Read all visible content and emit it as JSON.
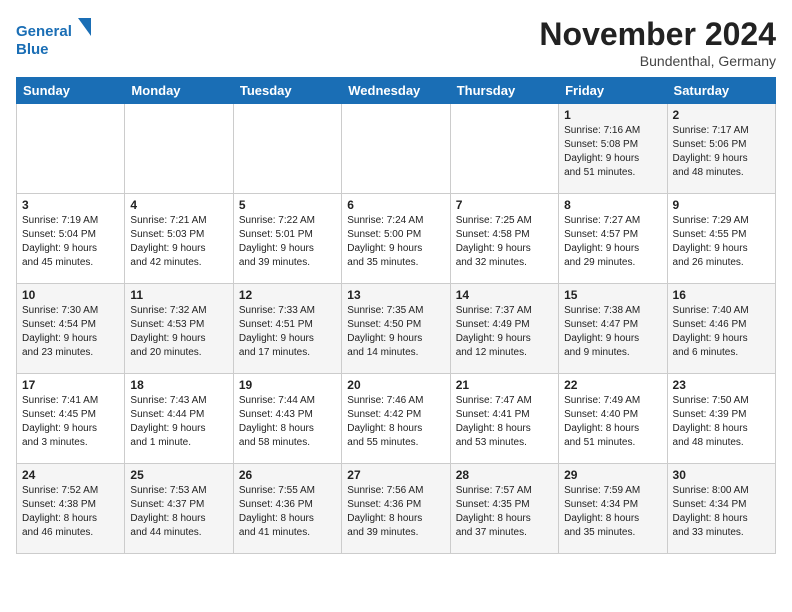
{
  "header": {
    "logo_line1": "General",
    "logo_line2": "Blue",
    "month": "November 2024",
    "location": "Bundenthal, Germany"
  },
  "weekdays": [
    "Sunday",
    "Monday",
    "Tuesday",
    "Wednesday",
    "Thursday",
    "Friday",
    "Saturday"
  ],
  "weeks": [
    [
      {
        "day": "",
        "info": ""
      },
      {
        "day": "",
        "info": ""
      },
      {
        "day": "",
        "info": ""
      },
      {
        "day": "",
        "info": ""
      },
      {
        "day": "",
        "info": ""
      },
      {
        "day": "1",
        "info": "Sunrise: 7:16 AM\nSunset: 5:08 PM\nDaylight: 9 hours\nand 51 minutes."
      },
      {
        "day": "2",
        "info": "Sunrise: 7:17 AM\nSunset: 5:06 PM\nDaylight: 9 hours\nand 48 minutes."
      }
    ],
    [
      {
        "day": "3",
        "info": "Sunrise: 7:19 AM\nSunset: 5:04 PM\nDaylight: 9 hours\nand 45 minutes."
      },
      {
        "day": "4",
        "info": "Sunrise: 7:21 AM\nSunset: 5:03 PM\nDaylight: 9 hours\nand 42 minutes."
      },
      {
        "day": "5",
        "info": "Sunrise: 7:22 AM\nSunset: 5:01 PM\nDaylight: 9 hours\nand 39 minutes."
      },
      {
        "day": "6",
        "info": "Sunrise: 7:24 AM\nSunset: 5:00 PM\nDaylight: 9 hours\nand 35 minutes."
      },
      {
        "day": "7",
        "info": "Sunrise: 7:25 AM\nSunset: 4:58 PM\nDaylight: 9 hours\nand 32 minutes."
      },
      {
        "day": "8",
        "info": "Sunrise: 7:27 AM\nSunset: 4:57 PM\nDaylight: 9 hours\nand 29 minutes."
      },
      {
        "day": "9",
        "info": "Sunrise: 7:29 AM\nSunset: 4:55 PM\nDaylight: 9 hours\nand 26 minutes."
      }
    ],
    [
      {
        "day": "10",
        "info": "Sunrise: 7:30 AM\nSunset: 4:54 PM\nDaylight: 9 hours\nand 23 minutes."
      },
      {
        "day": "11",
        "info": "Sunrise: 7:32 AM\nSunset: 4:53 PM\nDaylight: 9 hours\nand 20 minutes."
      },
      {
        "day": "12",
        "info": "Sunrise: 7:33 AM\nSunset: 4:51 PM\nDaylight: 9 hours\nand 17 minutes."
      },
      {
        "day": "13",
        "info": "Sunrise: 7:35 AM\nSunset: 4:50 PM\nDaylight: 9 hours\nand 14 minutes."
      },
      {
        "day": "14",
        "info": "Sunrise: 7:37 AM\nSunset: 4:49 PM\nDaylight: 9 hours\nand 12 minutes."
      },
      {
        "day": "15",
        "info": "Sunrise: 7:38 AM\nSunset: 4:47 PM\nDaylight: 9 hours\nand 9 minutes."
      },
      {
        "day": "16",
        "info": "Sunrise: 7:40 AM\nSunset: 4:46 PM\nDaylight: 9 hours\nand 6 minutes."
      }
    ],
    [
      {
        "day": "17",
        "info": "Sunrise: 7:41 AM\nSunset: 4:45 PM\nDaylight: 9 hours\nand 3 minutes."
      },
      {
        "day": "18",
        "info": "Sunrise: 7:43 AM\nSunset: 4:44 PM\nDaylight: 9 hours\nand 1 minute."
      },
      {
        "day": "19",
        "info": "Sunrise: 7:44 AM\nSunset: 4:43 PM\nDaylight: 8 hours\nand 58 minutes."
      },
      {
        "day": "20",
        "info": "Sunrise: 7:46 AM\nSunset: 4:42 PM\nDaylight: 8 hours\nand 55 minutes."
      },
      {
        "day": "21",
        "info": "Sunrise: 7:47 AM\nSunset: 4:41 PM\nDaylight: 8 hours\nand 53 minutes."
      },
      {
        "day": "22",
        "info": "Sunrise: 7:49 AM\nSunset: 4:40 PM\nDaylight: 8 hours\nand 51 minutes."
      },
      {
        "day": "23",
        "info": "Sunrise: 7:50 AM\nSunset: 4:39 PM\nDaylight: 8 hours\nand 48 minutes."
      }
    ],
    [
      {
        "day": "24",
        "info": "Sunrise: 7:52 AM\nSunset: 4:38 PM\nDaylight: 8 hours\nand 46 minutes."
      },
      {
        "day": "25",
        "info": "Sunrise: 7:53 AM\nSunset: 4:37 PM\nDaylight: 8 hours\nand 44 minutes."
      },
      {
        "day": "26",
        "info": "Sunrise: 7:55 AM\nSunset: 4:36 PM\nDaylight: 8 hours\nand 41 minutes."
      },
      {
        "day": "27",
        "info": "Sunrise: 7:56 AM\nSunset: 4:36 PM\nDaylight: 8 hours\nand 39 minutes."
      },
      {
        "day": "28",
        "info": "Sunrise: 7:57 AM\nSunset: 4:35 PM\nDaylight: 8 hours\nand 37 minutes."
      },
      {
        "day": "29",
        "info": "Sunrise: 7:59 AM\nSunset: 4:34 PM\nDaylight: 8 hours\nand 35 minutes."
      },
      {
        "day": "30",
        "info": "Sunrise: 8:00 AM\nSunset: 4:34 PM\nDaylight: 8 hours\nand 33 minutes."
      }
    ]
  ]
}
